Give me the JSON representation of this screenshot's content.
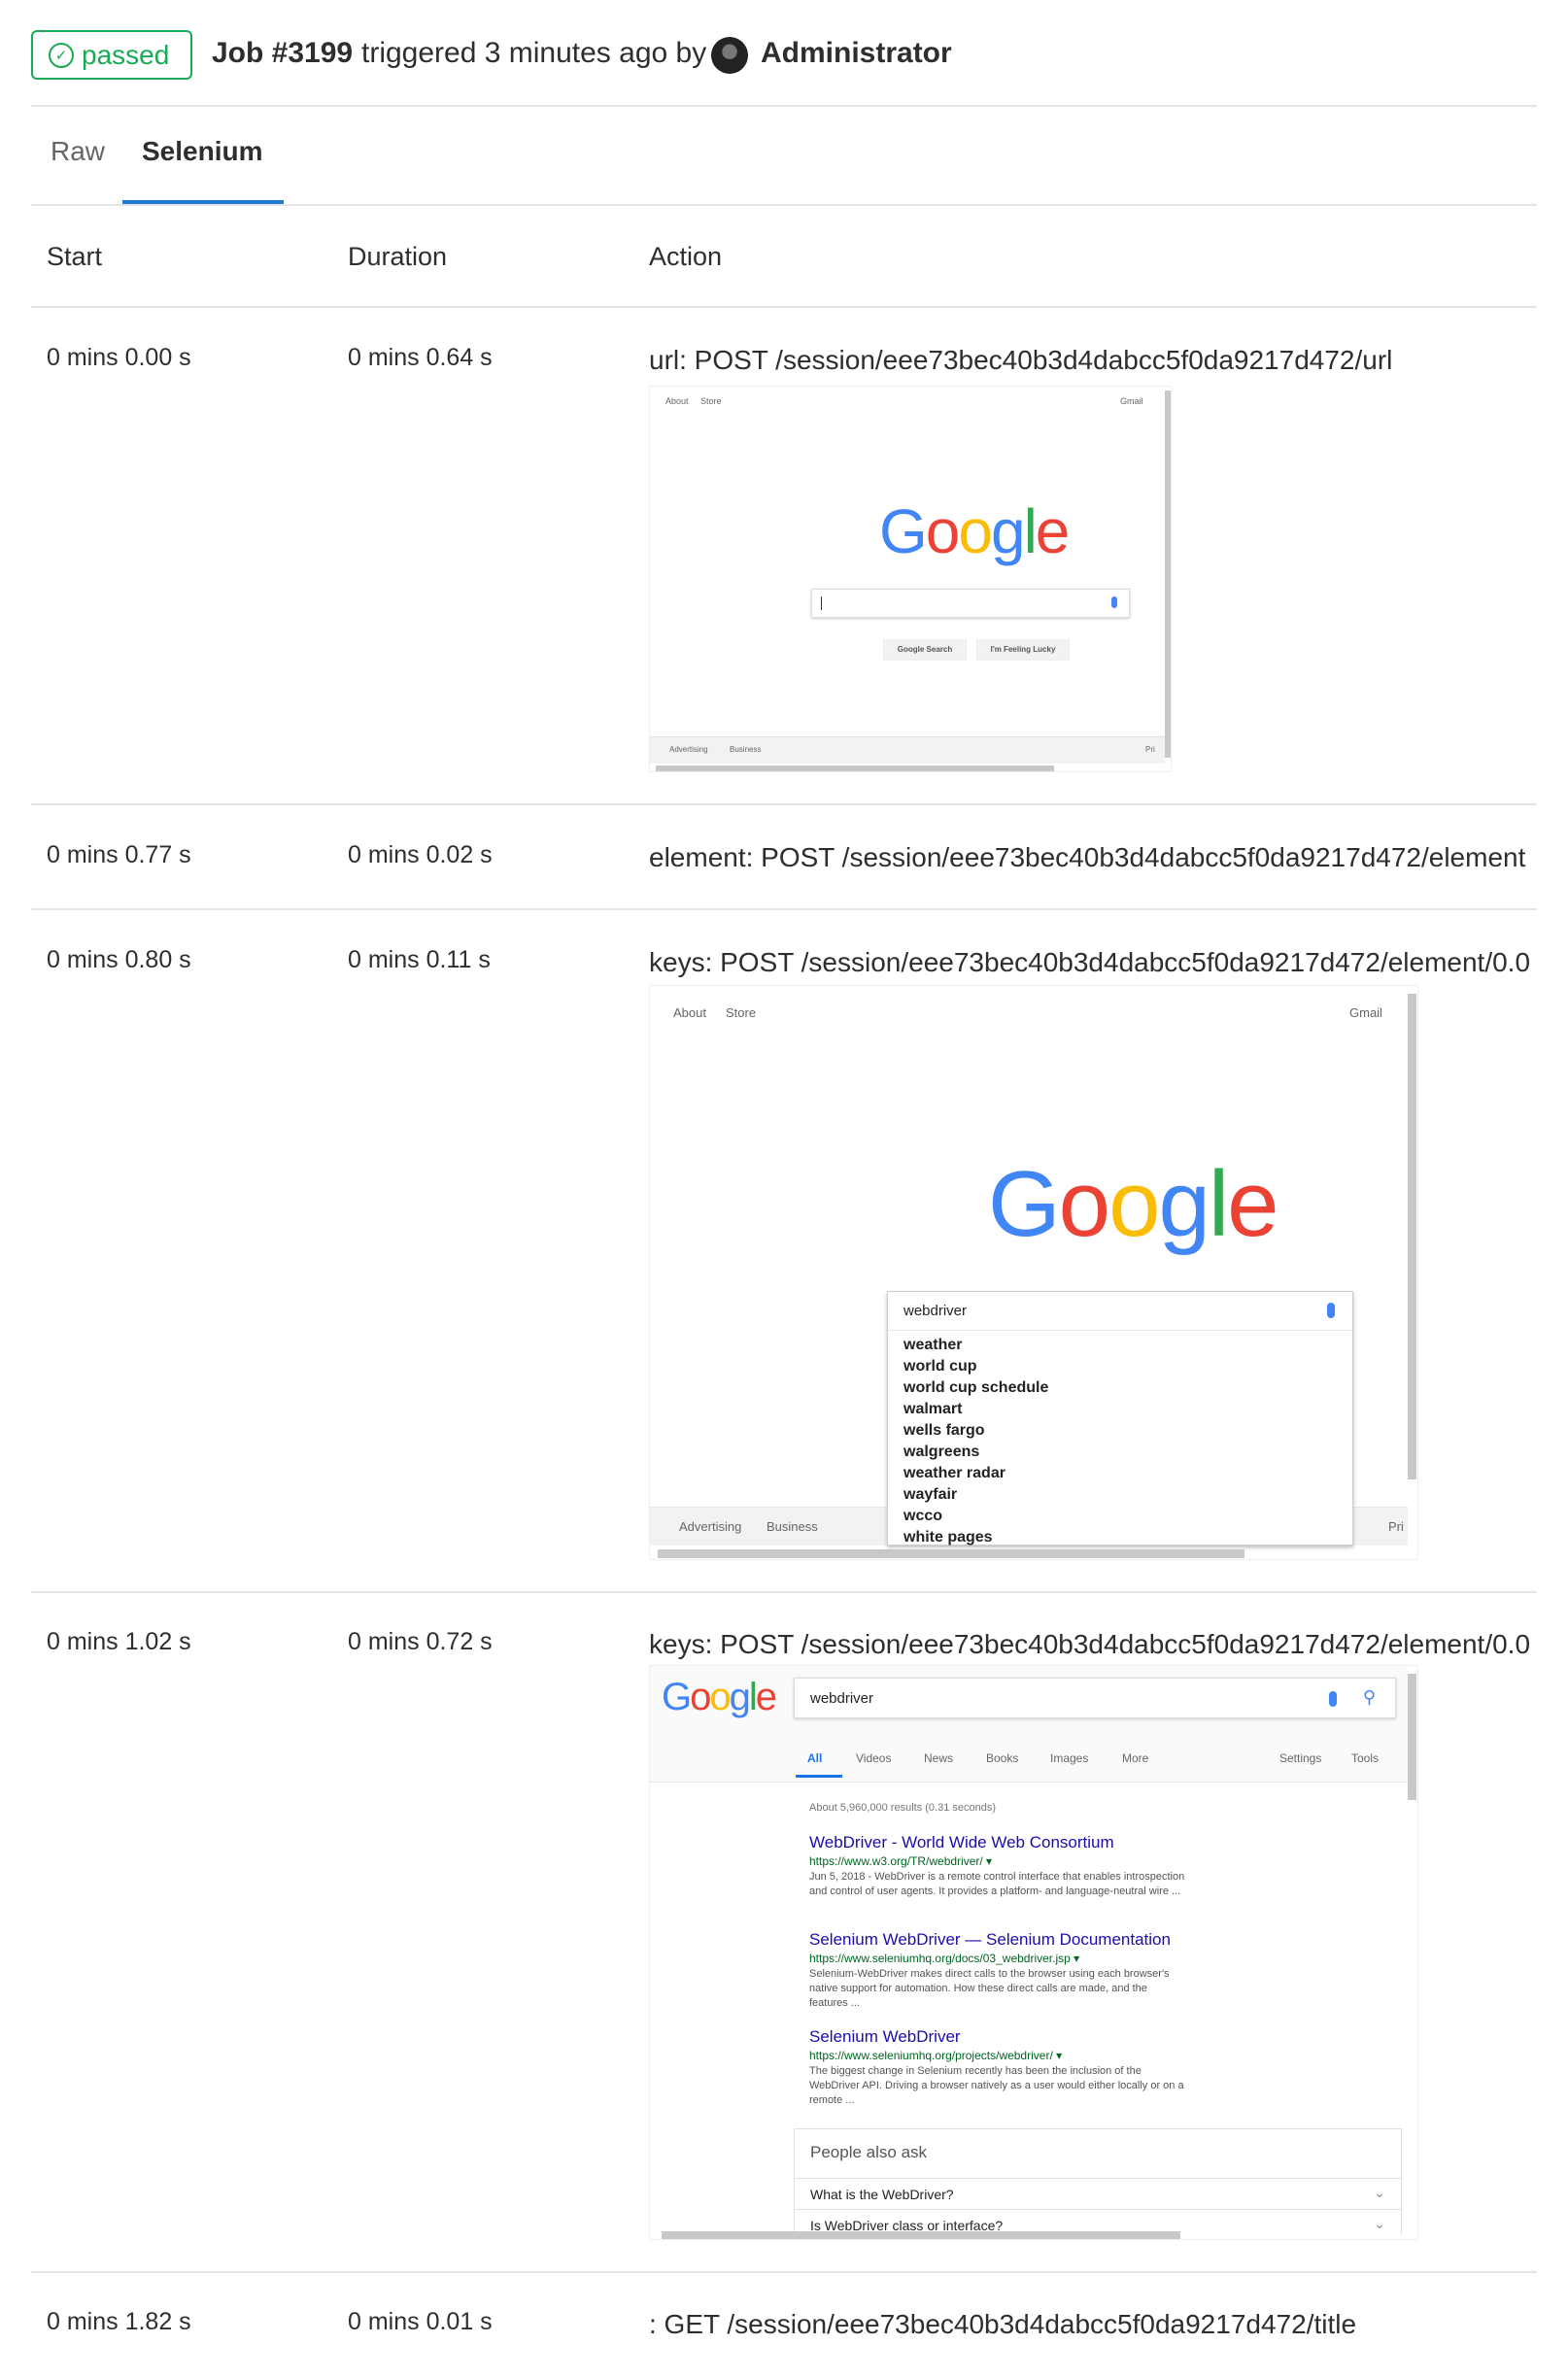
{
  "header": {
    "status": "passed",
    "job": "Job #3199",
    "triggered": "triggered 3 minutes ago by",
    "user": "Administrator"
  },
  "tabs": [
    "Raw",
    "Selenium"
  ],
  "table": {
    "columns": [
      "Start",
      "Duration",
      "Action"
    ],
    "rows": [
      {
        "start": "0 mins 0.00 s",
        "duration": "0 mins 0.64 s",
        "action": "url: POST /session/eee73bec40b3d4dabcc5f0da9217d472/url"
      },
      {
        "start": "0 mins 0.77 s",
        "duration": "0 mins 0.02 s",
        "action": "element: POST /session/eee73bec40b3d4dabcc5f0da9217d472/element"
      },
      {
        "start": "0 mins 0.80 s",
        "duration": "0 mins 0.11 s",
        "action": "keys: POST /session/eee73bec40b3d4dabcc5f0da9217d472/element/0.0"
      },
      {
        "start": "0 mins 1.02 s",
        "duration": "0 mins 0.72 s",
        "action": "keys: POST /session/eee73bec40b3d4dabcc5f0da9217d472/element/0.0"
      },
      {
        "start": "0 mins 1.82 s",
        "duration": "0 mins 0.01 s",
        "action": ": GET /session/eee73bec40b3d4dabcc5f0da9217d472/title"
      }
    ]
  },
  "shot1": {
    "logo": [
      "G",
      "o",
      "o",
      "g",
      "l",
      "e"
    ],
    "nav_left": [
      "About",
      "Store"
    ],
    "nav_right": "Gmail",
    "btn_search": "Google Search",
    "btn_lucky": "I'm Feeling Lucky",
    "footer": [
      "Advertising",
      "Business"
    ],
    "footer_right": "Pri"
  },
  "shot2": {
    "nav_left": [
      "About",
      "Store"
    ],
    "nav_right": "Gmail",
    "query": "webdriver",
    "suggestions": [
      "weather",
      "world cup",
      "world cup schedule",
      "walmart",
      "wells fargo",
      "walgreens",
      "weather radar",
      "wayfair",
      "wcco",
      "white pages"
    ],
    "footer": [
      "Advertising",
      "Business"
    ],
    "footer_right": "Pri"
  },
  "shot3": {
    "query": "webdriver",
    "tabs": [
      "All",
      "Videos",
      "News",
      "Books",
      "Images",
      "More"
    ],
    "tools": [
      "Settings",
      "Tools"
    ],
    "stats": "About 5,960,000 results (0.31 seconds)",
    "results": [
      {
        "title": "WebDriver - World Wide Web Consortium",
        "url": "https://www.w3.org/TR/webdriver/ ▾",
        "snippet": "Jun 5, 2018 - WebDriver is a remote control interface that enables introspection and control of user agents. It provides a platform- and language-neutral wire ..."
      },
      {
        "title": "Selenium WebDriver — Selenium Documentation",
        "url": "https://www.seleniumhq.org/docs/03_webdriver.jsp ▾",
        "snippet": "Selenium-WebDriver makes direct calls to the browser using each browser's native support for automation. How these direct calls are made, and the features ..."
      },
      {
        "title": "Selenium WebDriver",
        "url": "https://www.seleniumhq.org/projects/webdriver/ ▾",
        "snippet": "The biggest change in Selenium recently has been the inclusion of the WebDriver API. Driving a browser natively as a user would either locally or on a remote ..."
      }
    ],
    "paa_title": "People also ask",
    "paa": [
      "What is the WebDriver?",
      "Is WebDriver class or interface?"
    ]
  },
  "colors": {
    "success": "#1aaa55",
    "tab_active": "#1f78d1",
    "link": "#1a0dab",
    "url": "#006621"
  }
}
